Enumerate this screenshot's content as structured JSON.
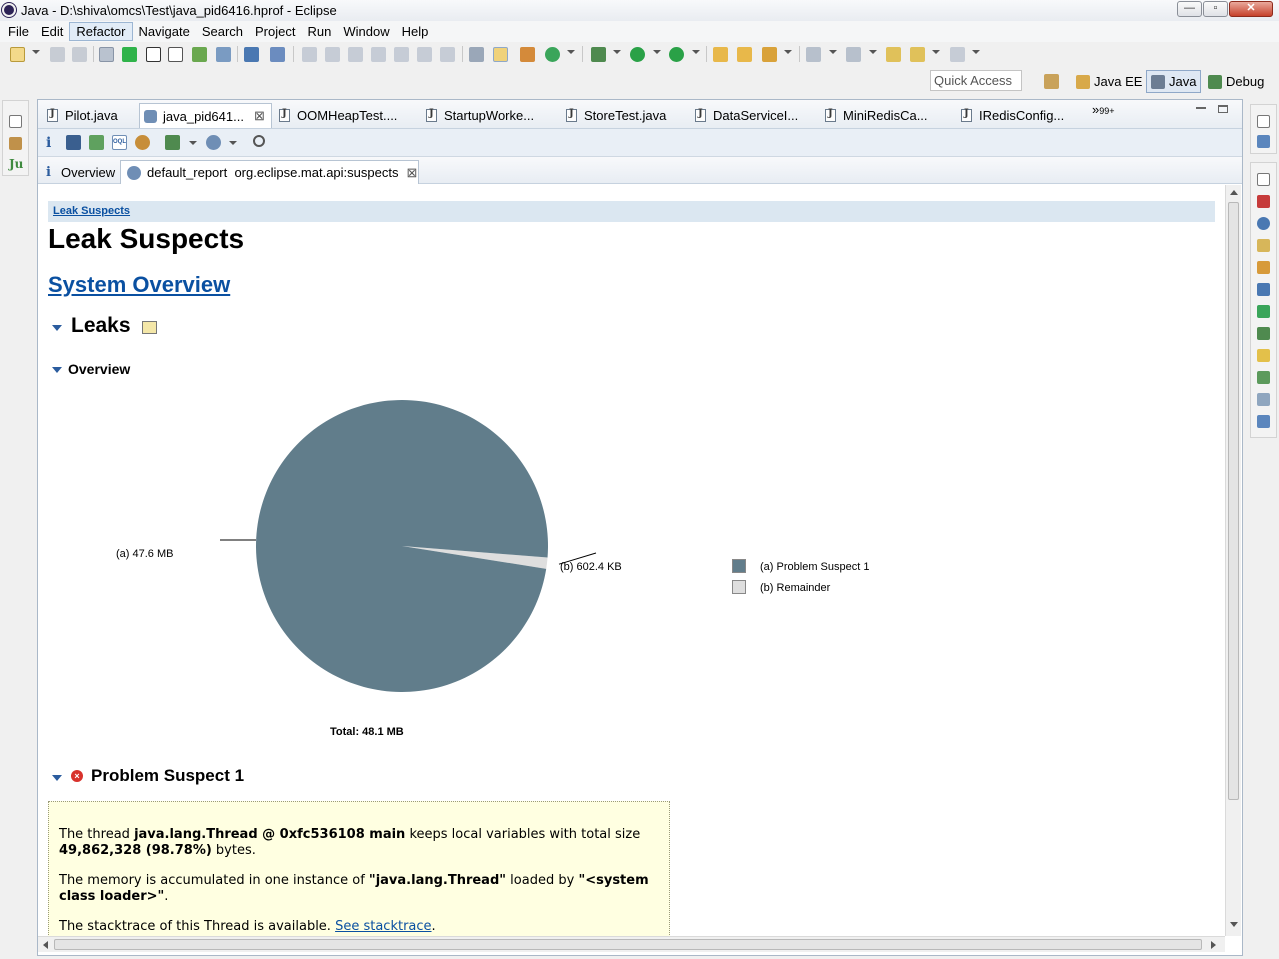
{
  "window": {
    "title": "Java - D:\\shiva\\omcs\\Test\\java_pid6416.hprof - Eclipse",
    "minimize": "—",
    "maximize": "▫",
    "close": "✕"
  },
  "menu": [
    "File",
    "Edit",
    "Refactor",
    "Navigate",
    "Search",
    "Project",
    "Run",
    "Window",
    "Help"
  ],
  "perspective_bar": {
    "quick_access_placeholder": "Quick Access",
    "perspectives": [
      "Java EE",
      "Java",
      "Debug"
    ],
    "active": "Java"
  },
  "left_stack": {
    "junit_label": "Ju"
  },
  "editor_tabs": [
    {
      "label": "Pilot.java",
      "active": false
    },
    {
      "label": "java_pid641...",
      "active": true,
      "closable": true
    },
    {
      "label": "OOMHeapTest....",
      "active": false
    },
    {
      "label": "StartupWorke...",
      "active": false
    },
    {
      "label": "StoreTest.java",
      "active": false
    },
    {
      "label": "DataServiceI...",
      "active": false
    },
    {
      "label": "MiniRedisCa...",
      "active": false
    },
    {
      "label": "IRedisConfig...",
      "active": false
    }
  ],
  "tab_overflow": {
    "chevron": "»",
    "count": "99+"
  },
  "subtabs": {
    "overview": "Overview",
    "report": "default_report  org.eclipse.mat.api:suspects"
  },
  "report": {
    "breadcrumb": "Leak Suspects",
    "title": "Leak Suspects",
    "system_overview_link": "System Overview",
    "leaks_heading": "Leaks",
    "overview_heading": "Overview",
    "problem_suspect_heading": "Problem Suspect 1",
    "suspect_para1": {
      "pre": "The thread ",
      "thread": "java.lang.Thread @ 0xfc536108 main",
      "mid": " keeps local variables with total size ",
      "size": "49,862,328 (98.78%)",
      "post": " bytes."
    },
    "suspect_para2": {
      "pre": "The memory is accumulated in one instance of ",
      "cls": "\"java.lang.Thread\"",
      "mid": " loaded by ",
      "loader": "\"<system class loader>\"",
      "post": "."
    },
    "suspect_para3": {
      "pre": "The stacktrace of this Thread is available. ",
      "link": "See stacktrace",
      "post": "."
    }
  },
  "chart_data": {
    "type": "pie",
    "title": "",
    "unit": "MB",
    "slices": [
      {
        "key": "(a)",
        "name": "Problem Suspect 1",
        "label": "47.6 MB",
        "value": 47.5,
        "color": "#617d8b"
      },
      {
        "key": "(b)",
        "name": "Remainder",
        "label": "602.4 KB",
        "value": 0.6,
        "color": "#dedede"
      }
    ],
    "total_label": "Total: 48.1 MB",
    "legend_position": "right"
  }
}
